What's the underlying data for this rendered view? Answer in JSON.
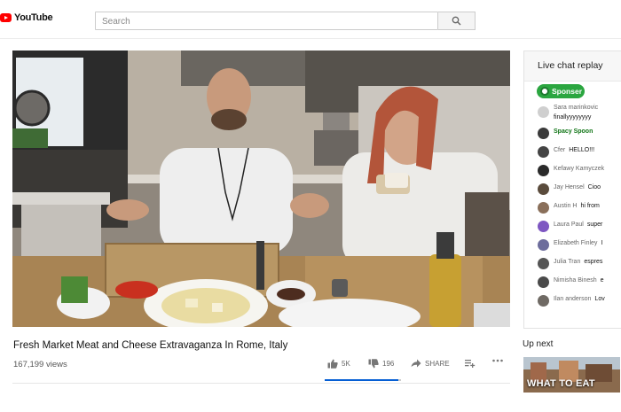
{
  "header": {
    "logo_text": "YouTube",
    "search_placeholder": "Search",
    "icons": {
      "logo": "youtube-play-icon",
      "search": "search-icon"
    },
    "brand_color": "#ff0000"
  },
  "video": {
    "title": "Fresh Market Meat and Cheese Extravaganza In Rome, Italy",
    "views": "167,199 views",
    "like_count": "5K",
    "dislike_count": "196",
    "share_label": "SHARE",
    "like_ratio": 0.96,
    "icons": {
      "like": "thumbs-up-icon",
      "dislike": "thumbs-down-icon",
      "share": "share-icon",
      "save": "add-to-playlist-icon",
      "more": "more-icon"
    }
  },
  "chat": {
    "title": "Live chat replay",
    "sponsor_label": "Sponser",
    "messages": [
      {
        "author": "Sara marinkovic",
        "text": "",
        "line2": "finallyyyyyyyy",
        "avatar": "#cfcfcf"
      },
      {
        "author": "Spacy Spoon",
        "text": "",
        "author_style": "member",
        "avatar": "#3a3a3a"
      },
      {
        "author": "Cfer",
        "text": "HELLO!!!",
        "avatar": "#444444"
      },
      {
        "author": "Kefawy Kamyczek",
        "text": "",
        "avatar": "#2a2a2a"
      },
      {
        "author": "Jay Hensel",
        "text": "Cioo",
        "avatar": "#5a4b3c"
      },
      {
        "author": "Austin H",
        "text": "hi from",
        "avatar": "#8a6f5a"
      },
      {
        "author": "Laura Paul",
        "text": "super",
        "avatar": "#7e57c2"
      },
      {
        "author": "Elizabeth Finley",
        "text": "I",
        "avatar": "#6d6d9c"
      },
      {
        "author": "Julia Tran",
        "text": "espres",
        "avatar": "#555555"
      },
      {
        "author": "Nimisha Binesh",
        "text": "e",
        "avatar": "#4a4a4a"
      },
      {
        "author": "Ilan anderson",
        "text": "Lov",
        "avatar": "#6f6a64"
      }
    ]
  },
  "up_next": {
    "label": "Up next",
    "thumbnail_text": "WHAT TO EAT"
  }
}
